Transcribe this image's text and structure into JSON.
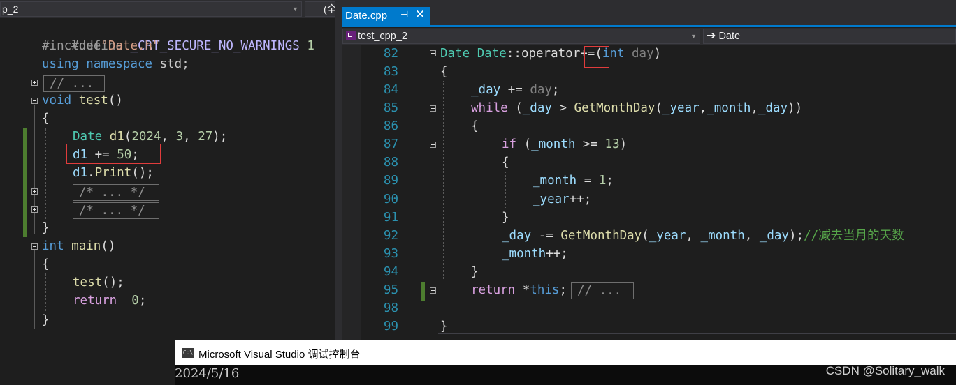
{
  "left_pane": {
    "nav_project": "p_2",
    "nav_scope": "(全",
    "code": {
      "define_kw": "#define",
      "define_macro": "_CRT_SECURE_NO_WARNINGS",
      "define_val": "1",
      "include_kw": "#include",
      "include_str": "\"Date.h\"",
      "using_kw": "using",
      "namespace_kw": "namespace",
      "std": "std;",
      "collapsed_comment": "// ...",
      "void_kw": "void",
      "test_fn": "test",
      "test_parens": "()",
      "brace_open": "{",
      "date_type": "Date",
      "d1_var": "d1",
      "d1_args_open": "(",
      "n2024": "2024",
      "comma1": ", ",
      "n3": "3",
      "comma2": ", ",
      "n27": "27",
      "d1_args_close": ");",
      "d1_plus": "d1",
      "plus_eq": " += ",
      "n50": "50",
      "semi": ";",
      "d1_print_var": "d1",
      "dot": ".",
      "print_fn": "Print",
      "print_parens": "();",
      "block_comment_1": "/* ... */",
      "block_comment_2": "/* ... */",
      "brace_close": "}",
      "int_kw": "int",
      "main_fn": "main",
      "main_parens": "()",
      "main_brace_open": "{",
      "call_test_fn": "test",
      "call_test_parens": "();",
      "return_kw": "return",
      "zero": "0",
      "zero_semi": ";",
      "main_brace_close": "}"
    }
  },
  "right_pane": {
    "tab_label": "Date.cpp",
    "tab_pin_glyph": "⊣",
    "tab_close_glyph": "✕",
    "nav_project": "test_cpp_2",
    "nav_scope": "Date",
    "line_numbers": [
      "82",
      "83",
      "84",
      "85",
      "86",
      "87",
      "88",
      "89",
      "90",
      "91",
      "92",
      "93",
      "94",
      "95",
      "98",
      "99"
    ],
    "code": {
      "l82_type": "Date",
      "l82_class": "Date",
      "l82_sep": "::",
      "l82_op": "operator",
      "l82_opsym": "+=",
      "l82_paren": "(",
      "l82_int": "int",
      "l82_param": "day",
      "l82_close": ")",
      "l83": "{",
      "l84_day": "_day",
      "l84_op": " += ",
      "l84_param": "day",
      "l84_semi": ";",
      "l85_while": "while",
      "l85_open": " (",
      "l85_day": "_day",
      "l85_gt": " > ",
      "l85_fn": "GetMonthDay",
      "l85_p": "(",
      "l85_year": "_year",
      "l85_c1": ",",
      "l85_month": "_month",
      "l85_c2": ",",
      "l85_day2": "_day",
      "l85_close": "))",
      "l86": "{",
      "l87_if": "if",
      "l87_open": " (",
      "l87_month": "_month",
      "l87_ge": " >= ",
      "l87_num": "13",
      "l87_close": ")",
      "l88": "{",
      "l89_month": "_month",
      "l89_eq": " = ",
      "l89_num": "1",
      "l89_semi": ";",
      "l90_year": "_year",
      "l90_inc": "++;",
      "l91": "}",
      "l92_day": "_day",
      "l92_op": " -= ",
      "l92_fn": "GetMonthDay",
      "l92_p": "(",
      "l92_year": "_year",
      "l92_c1": ", ",
      "l92_month": "_month",
      "l92_c2": ", ",
      "l92_day2": "_day",
      "l92_close": ");",
      "l92_comment": "//减去当月的天数",
      "l93_month": "_month",
      "l93_inc": "++;",
      "l94": "}",
      "l95_return": "return",
      "l95_star": " *",
      "l95_this": "this",
      "l95_semi": ";",
      "l95_collapsed": "// ...",
      "l99": "}"
    }
  },
  "console": {
    "title": "Microsoft Visual Studio 调试控制台",
    "icon_text": "C:\\",
    "output": "2024/5/16"
  },
  "watermark": "CSDN @Solitary_walk",
  "colors": {
    "editor_bg": "#1e1e1e",
    "tab_active": "#007acc",
    "highlight_box": "#e03c3c",
    "change_bar": "#4d7d2f"
  }
}
